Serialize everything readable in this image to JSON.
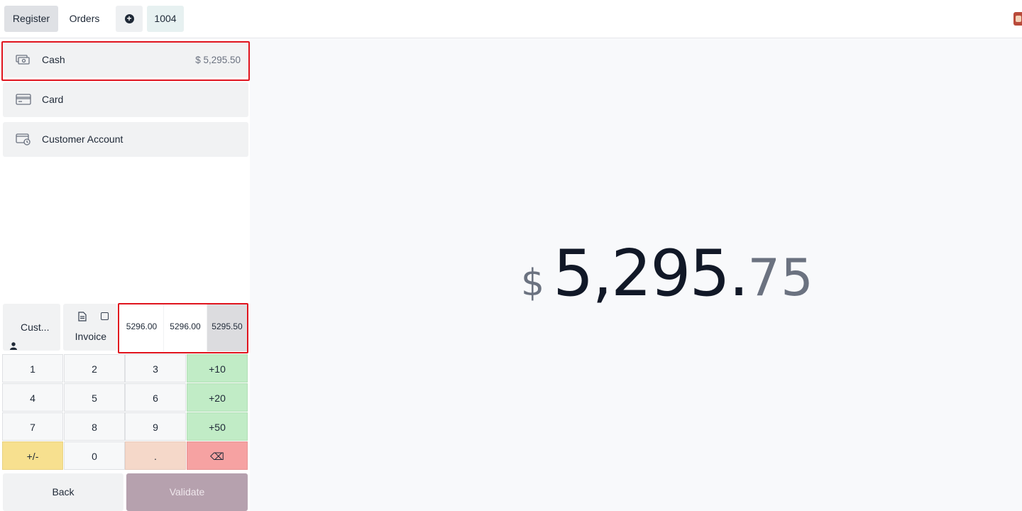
{
  "topbar": {
    "register_label": "Register",
    "orders_label": "Orders",
    "add_order_symbol": "+",
    "order_number": "1004"
  },
  "payment_methods": [
    {
      "name": "Cash",
      "amount": "$ 5,295.50",
      "icon": "cash-icon"
    },
    {
      "name": "Card",
      "amount": "",
      "icon": "card-icon"
    },
    {
      "name": "Customer Account",
      "amount": "",
      "icon": "wallet-icon"
    }
  ],
  "actions": {
    "customer_label": "Cust...",
    "invoice_label": "Invoice"
  },
  "quick_amounts": [
    "5296.00",
    "5296.00",
    "5295.50"
  ],
  "numpad": {
    "keys": [
      "1",
      "2",
      "3",
      "+10",
      "4",
      "5",
      "6",
      "+20",
      "7",
      "8",
      "9",
      "+50",
      "+/-",
      "0",
      ".",
      "⌫"
    ]
  },
  "footer": {
    "back_label": "Back",
    "validate_label": "Validate"
  },
  "total": {
    "currency": "$",
    "integer": "5,295.",
    "decimals": "75"
  },
  "colors": {
    "highlight": "#e0141e",
    "green_key": "#c1ecc6",
    "yellow_key": "#f7e08f",
    "peach_key": "#f5d8c9",
    "red_key": "#f6a2a2",
    "validate": "#b6a1ae"
  }
}
